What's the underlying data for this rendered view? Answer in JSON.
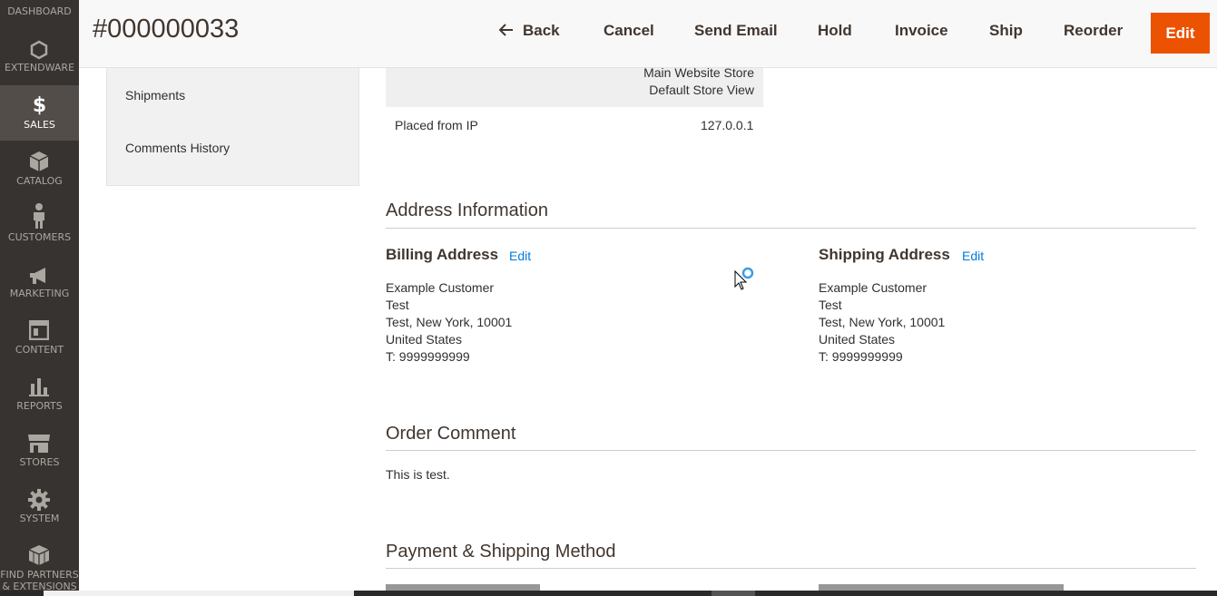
{
  "sidebar": {
    "items": [
      {
        "label": "DASHBOARD",
        "icon": "dashboard-icon"
      },
      {
        "label": "EXTENDWARE",
        "icon": "hexagon-icon"
      },
      {
        "label": "SALES",
        "icon": "dollar-icon",
        "active": true
      },
      {
        "label": "CATALOG",
        "icon": "box-icon"
      },
      {
        "label": "CUSTOMERS",
        "icon": "person-icon"
      },
      {
        "label": "MARKETING",
        "icon": "megaphone-icon"
      },
      {
        "label": "CONTENT",
        "icon": "layout-icon"
      },
      {
        "label": "REPORTS",
        "icon": "bar-chart-icon"
      },
      {
        "label": "STORES",
        "icon": "storefront-icon"
      },
      {
        "label": "SYSTEM",
        "icon": "gear-icon"
      },
      {
        "label": "FIND PARTNERS\n& EXTENSIONS",
        "label_1": "FIND PARTNERS",
        "label_2": "& EXTENSIONS",
        "icon": "blocks-icon"
      }
    ]
  },
  "header": {
    "title": "#000000033",
    "back": "Back",
    "cancel": "Cancel",
    "send_email": "Send Email",
    "hold": "Hold",
    "invoice": "Invoice",
    "ship": "Ship",
    "reorder": "Reorder",
    "edit": "Edit",
    "accent_color": "#eb5202"
  },
  "tabs": {
    "shipments": "Shipments",
    "comments_history": "Comments History"
  },
  "order_info": {
    "store_line_1": "Main Website Store",
    "store_line_2": "Default Store View",
    "placed_from_ip_label": "Placed from IP",
    "placed_from_ip_value": "127.0.0.1"
  },
  "address": {
    "section_title": "Address Information",
    "billing": {
      "title": "Billing Address",
      "edit": "Edit",
      "lines": [
        "Example Customer",
        "Test",
        "Test, New York, 10001",
        "United States",
        "T: 9999999999"
      ]
    },
    "shipping": {
      "title": "Shipping Address",
      "edit": "Edit",
      "lines": [
        "Example Customer",
        "Test",
        "Test, New York, 10001",
        "United States",
        "T: 9999999999"
      ]
    }
  },
  "comment": {
    "section_title": "Order Comment",
    "text": "This is test."
  },
  "payment": {
    "section_title": "Payment & Shipping Method"
  }
}
